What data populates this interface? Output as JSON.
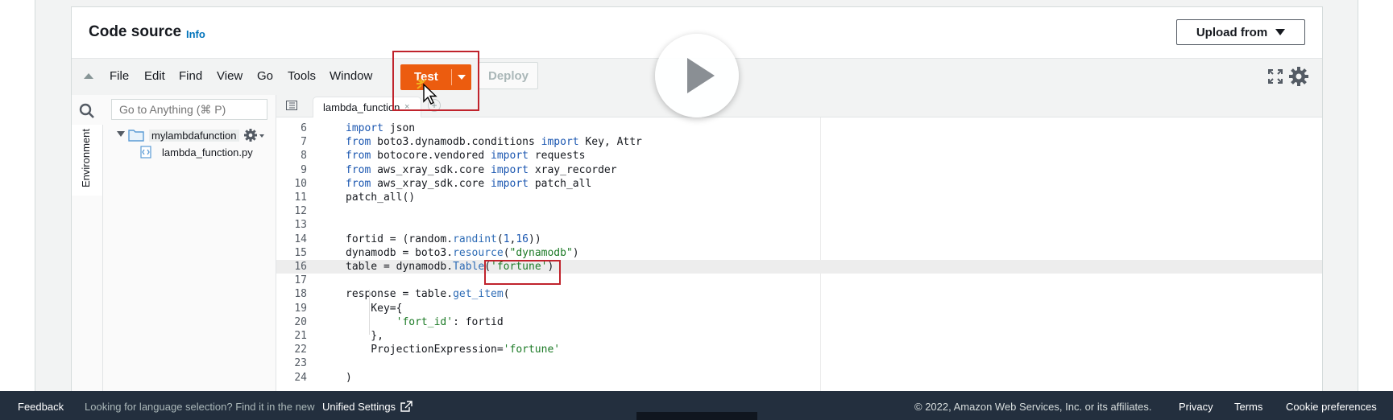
{
  "panel": {
    "title": "Code source",
    "info_link": "Info",
    "upload_button": "Upload from"
  },
  "toolbar": {
    "menu": [
      "File",
      "Edit",
      "Find",
      "View",
      "Go",
      "Tools",
      "Window"
    ],
    "test_button": "Test",
    "deploy_button": "Deploy"
  },
  "sidebar": {
    "search_placeholder": "Go to Anything (⌘ P)",
    "environment_tab": "Environment",
    "folder": "mylambdafunction",
    "file": "lambda_function.py"
  },
  "editor": {
    "tab_name": "lambda_function",
    "tab_close": "×",
    "add_tab": "+",
    "lines": [
      {
        "n": "6",
        "code": "import json"
      },
      {
        "n": "7",
        "code": "from boto3.dynamodb.conditions import Key, Attr"
      },
      {
        "n": "8",
        "code": "from botocore.vendored import requests"
      },
      {
        "n": "9",
        "code": "from aws_xray_sdk.core import xray_recorder"
      },
      {
        "n": "10",
        "code": "from aws_xray_sdk.core import patch_all"
      },
      {
        "n": "11",
        "code": "patch_all()"
      },
      {
        "n": "12",
        "code": ""
      },
      {
        "n": "13",
        "code": ""
      },
      {
        "n": "14",
        "code": "fortid = (random.randint(1,16))"
      },
      {
        "n": "15",
        "code": "dynamodb = boto3.resource(\"dynamodb\")"
      },
      {
        "n": "16",
        "code": "table = dynamodb.Table('fortune')"
      },
      {
        "n": "17",
        "code": ""
      },
      {
        "n": "18",
        "code": "response = table.get_item("
      },
      {
        "n": "19",
        "code": "    Key={"
      },
      {
        "n": "20",
        "code": "        'fort_id': fortid"
      },
      {
        "n": "21",
        "code": "    },"
      },
      {
        "n": "22",
        "code": "    ProjectionExpression='fortune'"
      },
      {
        "n": "23",
        "code": ""
      },
      {
        "n": "24",
        "code": ")"
      }
    ]
  },
  "footer": {
    "feedback": "Feedback",
    "language_notice": "Looking for language selection? Find it in the new",
    "unified_settings": "Unified Settings",
    "copyright": "© 2022, Amazon Web Services, Inc. or its affiliates.",
    "privacy": "Privacy",
    "terms": "Terms",
    "cookies": "Cookie preferences"
  },
  "colors": {
    "accent_orange": "#ec5c0f",
    "highlight_red": "#c0232c",
    "footer_bg": "#232f3e",
    "link_blue": "#0073bb"
  },
  "icons": [
    "collapse-icon",
    "fullscreen-icon",
    "gear-icon",
    "search-icon",
    "folder-icon",
    "file-icon",
    "play-icon",
    "cursor-icon",
    "external-link-icon"
  ]
}
